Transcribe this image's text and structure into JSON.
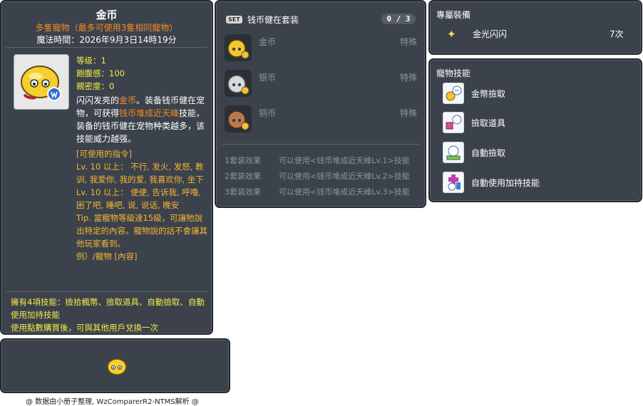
{
  "item_id": "05002809",
  "item": {
    "name": "金币",
    "subtitle": "多隻寵物（最多可使用3隻相同寵物）",
    "magic_time": "魔法時間：2026年9月3日14時19分",
    "stats": [
      "等级：1",
      "飽腹感：100",
      "親密度：0"
    ],
    "desc_pre": "闪闪发亮的",
    "desc_hl1": "金币",
    "desc_mid1": "。装备钱币健在宠物，可获得",
    "desc_hl2": "钱币堆成近天峰",
    "desc_post": "技能，装备的钱币健在宠物种类越多，该技能威力越强。",
    "cmd_header": "[可使用的指令]",
    "cmd_lv10a": "Lv. 10 以上： 不行, 发火, 发怒, 教训, 我爱你, 我的爱, 我喜欢你, 坐下",
    "cmd_lv10b": "Lv. 10 以上： 便便, 告诉我, 呼噜, 困了吧, 睡吧, 说, 说话, 晚安",
    "tip": "Tip. 當寵物等級達15級，可讓牠說出特定的內容。寵物說的話不會讓其他玩家看到。",
    "example": "例）/寵物 [內容]",
    "footer1": "擁有4項技能：撿拾楓幣、撿取道具、自動撿取、自動使用加持技能",
    "footer2": "使用點數購買後，可與其他用戶兌換一次"
  },
  "set": {
    "badge": "SET",
    "name": "钱币健在套装",
    "count": "0 / 3",
    "items": [
      {
        "name": "金币",
        "type": "特殊",
        "color": "#f2c531"
      },
      {
        "name": "银币",
        "type": "特殊",
        "color": "#d9d9d9"
      },
      {
        "name": "铜币",
        "type": "特殊",
        "color": "#b87a4f"
      }
    ],
    "effects": [
      {
        "n": "1套装效果",
        "t": "可以使用<钱币堆成近天峰Lv.1>技能"
      },
      {
        "n": "2套装效果",
        "t": "可以使用<钱币堆成近天峰Lv.2>技能"
      },
      {
        "n": "3套装效果",
        "t": "可以使用<钱币堆成近天峰Lv.3>技能"
      }
    ]
  },
  "equip": {
    "header": "專屬裝備",
    "icon": "sparkle-icon",
    "name": "金光闪闪",
    "count": "7次"
  },
  "skills": {
    "header": "寵物技能",
    "list": [
      {
        "name": "金幣撿取",
        "icon": "meso-pickup-icon"
      },
      {
        "name": "撿取道具",
        "icon": "item-pickup-icon"
      },
      {
        "name": "自動撿取",
        "icon": "auto-pickup-icon"
      },
      {
        "name": "自動使用加持技能",
        "icon": "auto-buff-icon"
      }
    ]
  },
  "credit": "@ 数据由小册子整理, WzComparerR2-NTMS解析 @"
}
